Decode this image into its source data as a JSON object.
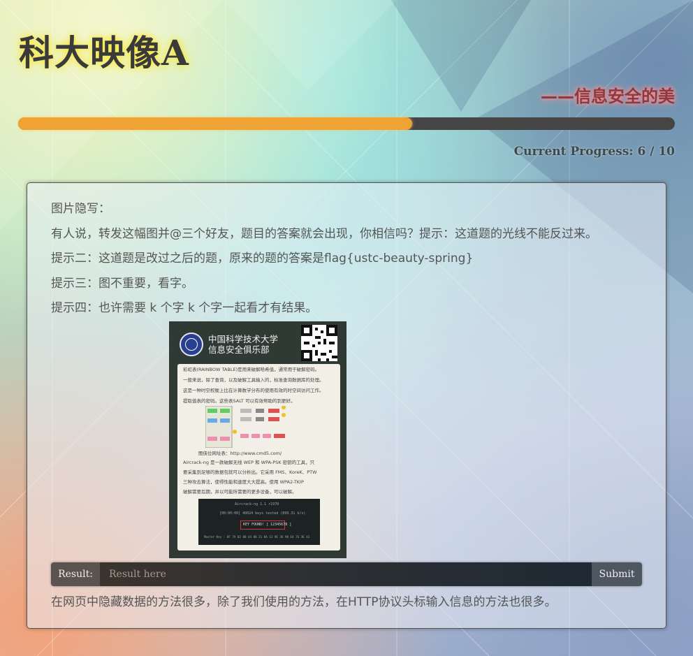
{
  "header": {
    "title": "科大映像A",
    "subtitle": "——信息安全的美"
  },
  "progress": {
    "current": 6,
    "total": 10,
    "label": "Current Progress: 6 / 10",
    "fill_color": "#eea334",
    "track_color": "#454545"
  },
  "question": {
    "lines": [
      "图片隐写：",
      "有人说，转发这幅图并@三个好友，题目的答案就会出现，你相信吗？提示：这道题的光线不能反过来。",
      "提示二：这道题是改过之后的题，原来的题的答案是flag{ustc-beauty-spring}",
      "提示三：图不重要，看字。",
      "提示四：也许需要 k 个字 k 个字一起看才有结果。"
    ]
  },
  "poster": {
    "title_line1": "中国科学技术大学",
    "title_line2": "信息安全俱乐部",
    "body_lines": [
      "彩虹表(RAINBOW TABLE)是用来破解哈希值，通常用于破解密码。",
      "一般来说，除了查询，以及破解工具输入的，标准查询数据库的处理。",
      "这是一种时空权衡上比在计算数学分布的使用有效的时空间访问工作。",
      "提取值表的密码。这些表SALT 可以有效帮助的到更好。"
    ],
    "url_line": "图侠位网址表：http://www.cmd5.com/",
    "body_lines2": [
      "Aircrack-ng 是一款破解无线 WEP 和 WPA-PSK 密钥的工具，只",
      "要采集到足够的数据包就可以分析出。它采用 FMS、KoreK、PTW",
      "三种攻击算法，使得性能和速度大大提高。使用 WPA2-TKIP",
      "破解需要后期，并以可能所需要的更多设备，可以破解。"
    ],
    "terminal_lines": [
      "Aircrack-ng 1.1 r1970",
      "[00:00:00] 40024 keys tested (899.31 k/s)",
      "KEY FOUND! [ 12345678 ]",
      "Master Key : 8F 7A 02 00 44 00 21 0A 13 9E 36 90 E4 76 3E 41"
    ]
  },
  "answer": {
    "label": "Result:",
    "placeholder": "Result here",
    "value": "",
    "submit_label": "Submit"
  },
  "footer_hint": "在网页中隐藏数据的方法很多，除了我们使用的方法，在HTTP协议头标输入信息的方法也很多。"
}
